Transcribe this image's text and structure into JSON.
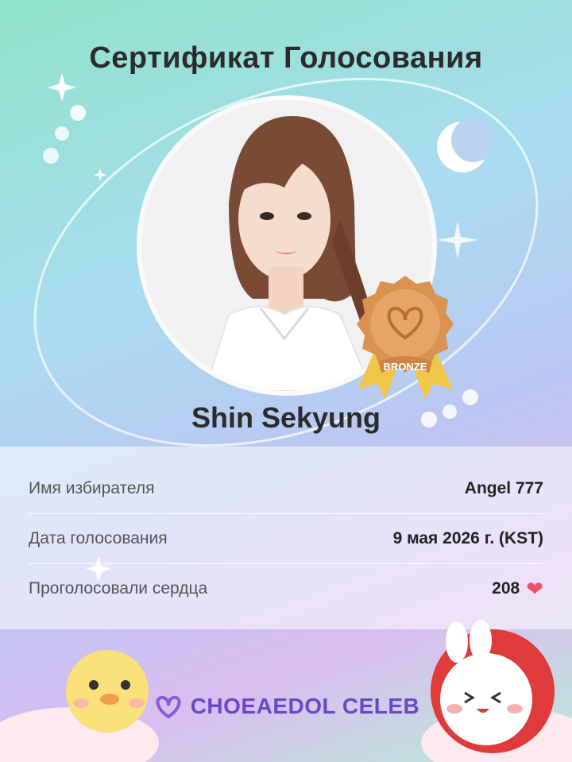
{
  "certificate": {
    "title": "Сертификат Голосования",
    "celeb_name": "Shin Sekyung",
    "badge_label": "BRONZE"
  },
  "info": {
    "rows": [
      {
        "label": "Имя избирателя",
        "value": "Angel 777"
      },
      {
        "label": "Дата голосования",
        "value": "9 мая 2026 г. (KST)"
      },
      {
        "label": "Проголосовали сердца",
        "value": "208"
      }
    ]
  },
  "brand": {
    "logo_text": "CHOEAEDOL CELEB"
  },
  "colors": {
    "heart": "#f0506a",
    "badge": "#d9924f",
    "ribbon": "#f0c64a",
    "logo": "#6a47c9"
  },
  "icons": [
    "star-sparkle-icon",
    "crescent-moon-icon",
    "heart-icon",
    "bronze-medal-icon",
    "logo-heart-icon"
  ]
}
